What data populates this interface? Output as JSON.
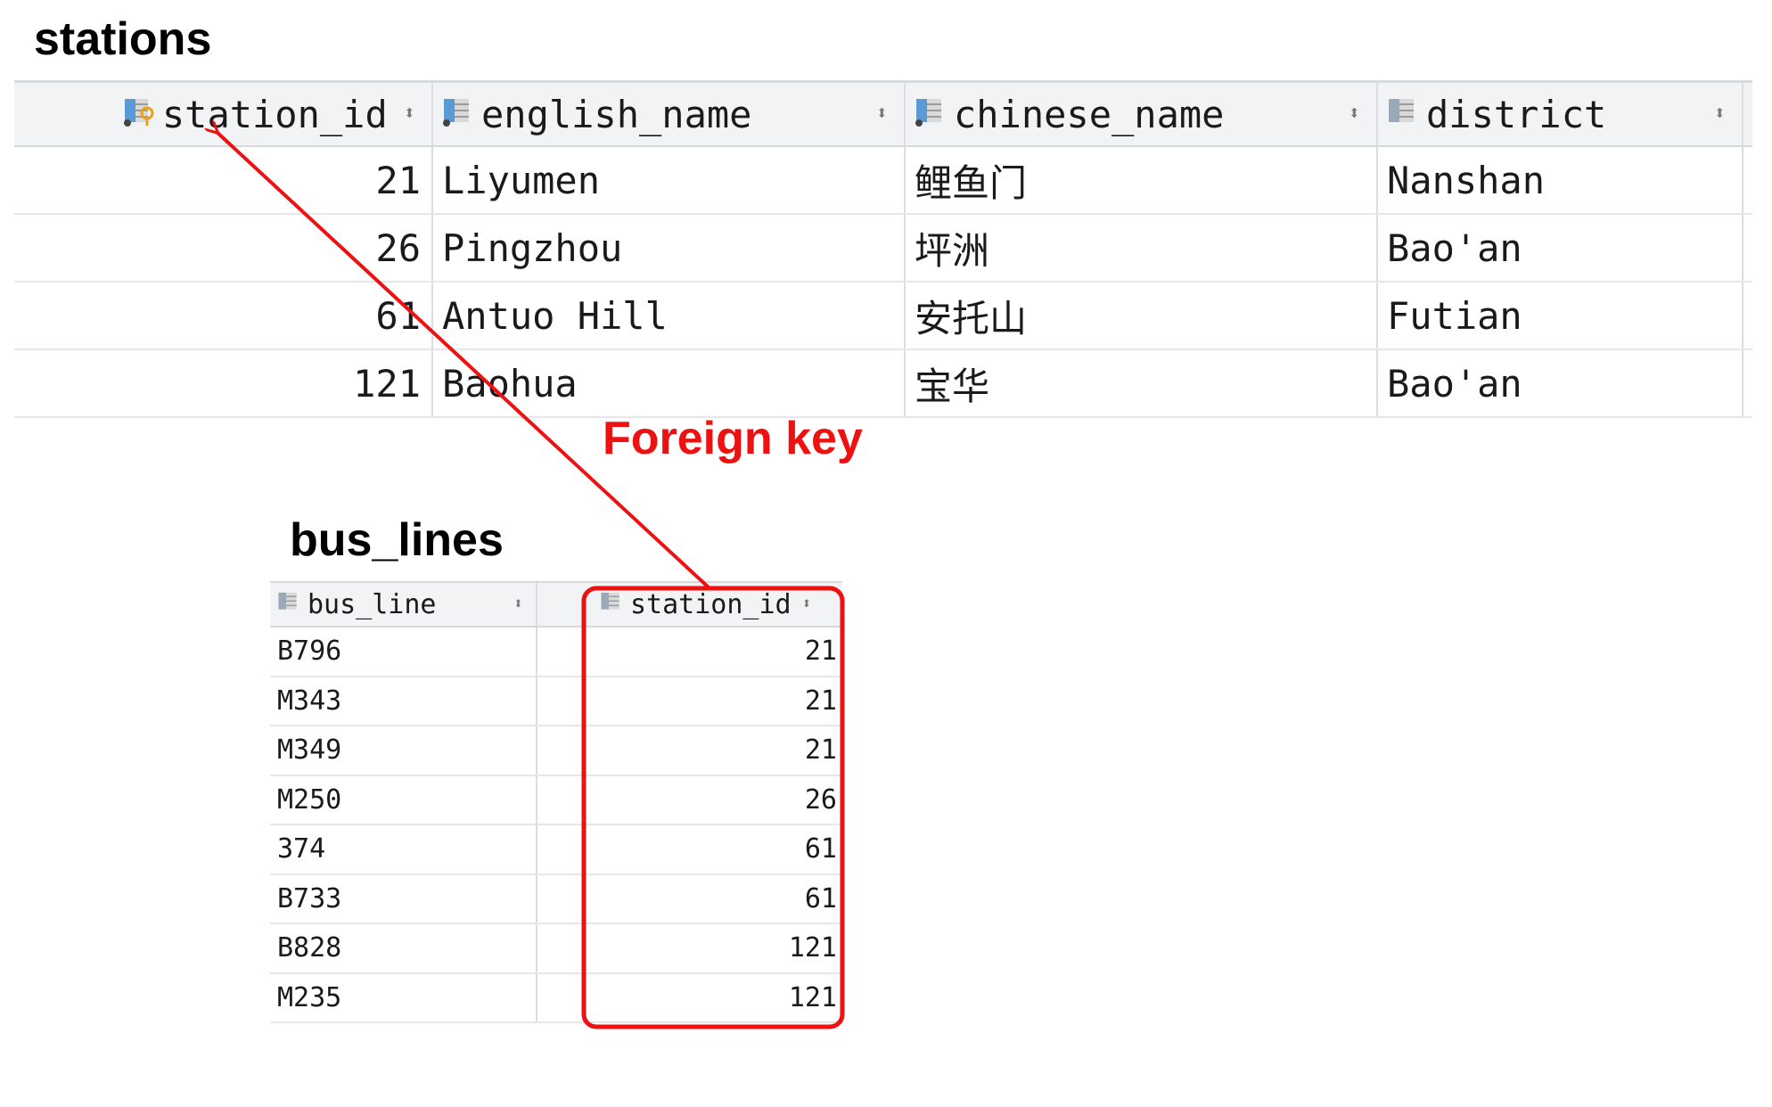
{
  "stations": {
    "title": "stations",
    "columns": [
      "station_id",
      "english_name",
      "chinese_name",
      "district"
    ],
    "rows": [
      [
        "21",
        "Liyumen",
        "鲤鱼门",
        "Nanshan"
      ],
      [
        "26",
        "Pingzhou",
        "坪洲",
        "Bao'an"
      ],
      [
        "61",
        "Antuo Hill",
        "安托山",
        "Futian"
      ],
      [
        "121",
        "Baohua",
        "宝华",
        "Bao'an"
      ]
    ]
  },
  "bus_lines": {
    "title": "bus_lines",
    "columns": [
      "bus_line",
      "station_id"
    ],
    "rows": [
      [
        "B796",
        "21"
      ],
      [
        "M343",
        "21"
      ],
      [
        "M349",
        "21"
      ],
      [
        "M250",
        "26"
      ],
      [
        "374",
        "61"
      ],
      [
        "B733",
        "61"
      ],
      [
        "B828",
        "121"
      ],
      [
        "M235",
        "121"
      ]
    ]
  },
  "annotation": {
    "label": "Foreign key",
    "color": "#ee1111"
  },
  "icons": {
    "primary_key_column": "key-column-icon",
    "column": "table-column-icon",
    "sort": "sort-arrows-icon"
  }
}
